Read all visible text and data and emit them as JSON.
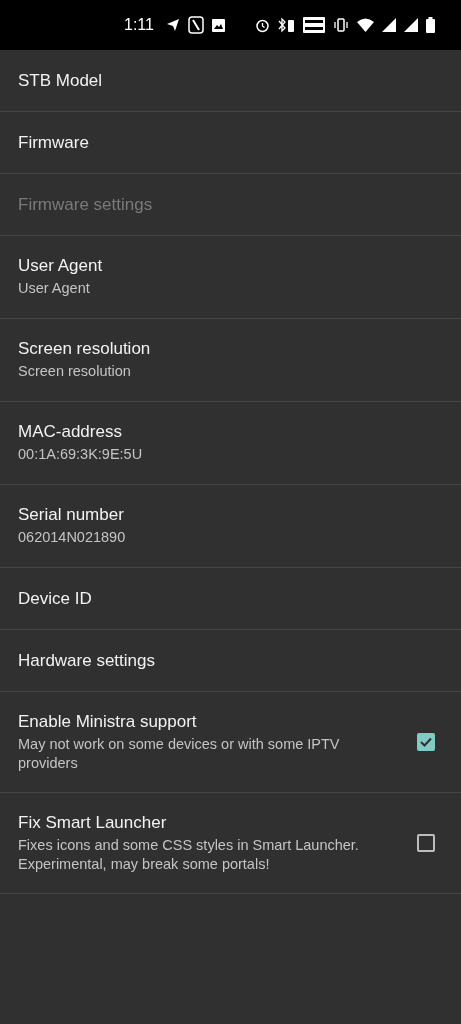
{
  "status_bar": {
    "time": "1:11"
  },
  "settings": [
    {
      "kind": "plain",
      "title": "STB Model",
      "disabled": false
    },
    {
      "kind": "plain",
      "title": "Firmware",
      "disabled": false
    },
    {
      "kind": "plain",
      "title": "Firmware settings",
      "disabled": true
    },
    {
      "kind": "plain",
      "title": "User Agent",
      "summary": "User Agent",
      "disabled": false
    },
    {
      "kind": "plain",
      "title": "Screen resolution",
      "summary": "Screen resolution",
      "disabled": false
    },
    {
      "kind": "plain",
      "title": "MAC-address",
      "summary": "00:1A:69:3K:9E:5U",
      "disabled": false
    },
    {
      "kind": "plain",
      "title": "Serial number",
      "summary": "062014N021890",
      "disabled": false
    },
    {
      "kind": "plain",
      "title": "Device ID",
      "disabled": false
    },
    {
      "kind": "plain",
      "title": "Hardware settings",
      "disabled": false
    },
    {
      "kind": "checkbox",
      "title": "Enable Ministra support",
      "summary": "May not work on some devices or with some IPTV providers",
      "checked": true,
      "disabled": false
    },
    {
      "kind": "checkbox",
      "title": "Fix Smart Launcher",
      "summary": "Fixes icons and some CSS styles in Smart Launcher. Experimental, may break some portals!",
      "checked": false,
      "disabled": false
    }
  ]
}
